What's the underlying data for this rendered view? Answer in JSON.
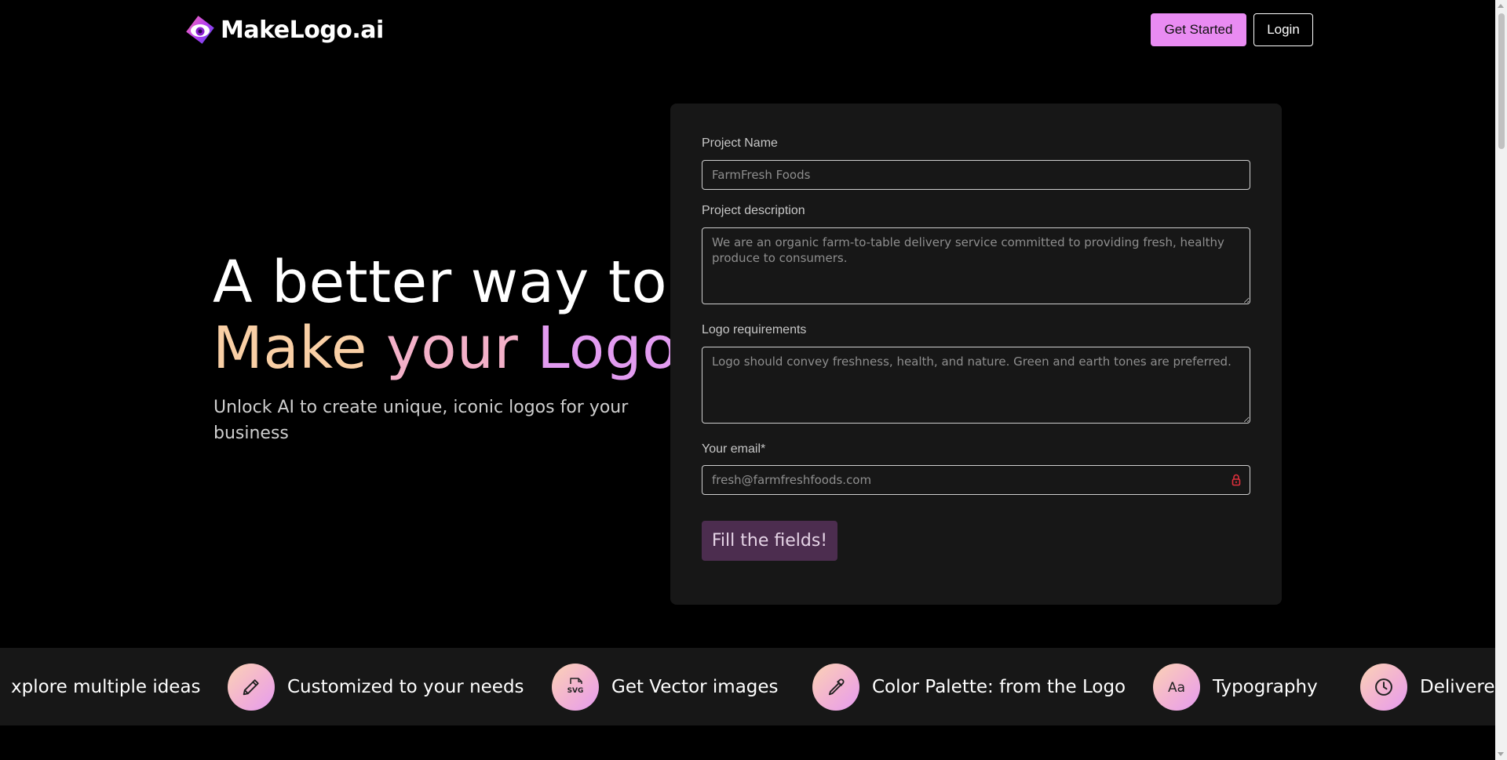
{
  "nav": {
    "brand": "MakeLogo.ai",
    "get_started_label": "Get Started",
    "login_label": "Login"
  },
  "hero": {
    "line1": "A better way to",
    "line2_words": [
      "Make",
      "your",
      "Logo"
    ],
    "subtitle": "Unlock AI to create unique, iconic logos for your business"
  },
  "form": {
    "project_name": {
      "label": "Project Name",
      "placeholder": "FarmFresh Foods"
    },
    "project_description": {
      "label": "Project description",
      "placeholder": "We are an organic farm-to-table delivery service committed to providing fresh, healthy produce to consumers."
    },
    "logo_requirements": {
      "label": "Logo requirements",
      "placeholder": "Logo should convey freshness, health, and nature. Green and earth tones are preferred."
    },
    "email": {
      "label": "Your email*",
      "placeholder": "fresh@farmfreshfoods.com"
    },
    "submit_label": "Fill the fields!"
  },
  "features": [
    {
      "label": "xplore multiple ideas",
      "icon": "lightbulb-icon"
    },
    {
      "label": "Customized to your needs",
      "icon": "pencil-icon"
    },
    {
      "label": "Get Vector images",
      "icon": "svg-file-icon",
      "icon_text": "SVG"
    },
    {
      "label": "Color Palette: from the Logo",
      "icon": "eyedropper-icon"
    },
    {
      "label": "Typography",
      "icon": "typography-icon",
      "icon_text": "Aa"
    },
    {
      "label": "Delivere",
      "icon": "clock-icon"
    }
  ],
  "colors": {
    "accent": "#e98bf2",
    "background": "#000000",
    "card": "#171717",
    "gradient_peach": "#f9cfa5",
    "gradient_pink": "#f3b0c8",
    "gradient_violet": "#e29bf0",
    "submit_disabled": "#4c2d4f",
    "lock": "#e0303c"
  }
}
